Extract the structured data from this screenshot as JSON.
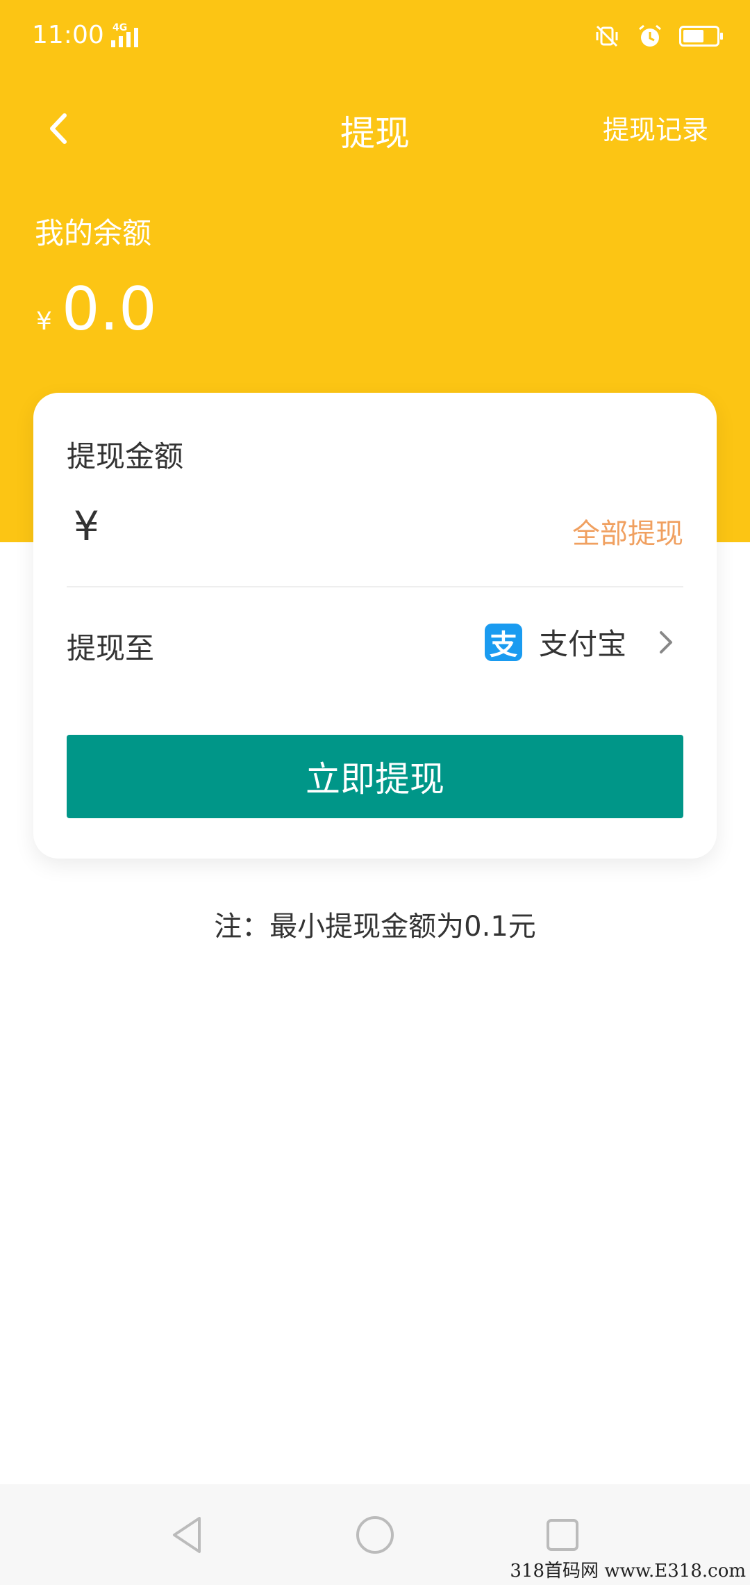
{
  "status_bar": {
    "time": "11:00",
    "network": "4G"
  },
  "nav": {
    "title": "提现",
    "right_link": "提现记录"
  },
  "balance": {
    "label": "我的余额",
    "currency": "¥",
    "amount": "0.0"
  },
  "form": {
    "title": "提现金额",
    "currency": "¥",
    "amount_value": "",
    "withdraw_all_label": "全部提现",
    "destination_label": "提现至",
    "destination_logo_text": "支",
    "destination_name": "支付宝",
    "submit_label": "立即提现"
  },
  "note": "注：最小提现金额为0.1元",
  "watermark": "318首码网 www.E318.com",
  "colors": {
    "header": "#FCC514",
    "primary_button": "#009688",
    "accent_link": "#F0A060",
    "alipay": "#1A9BF0"
  },
  "icons": {
    "back": "chevron-left-icon",
    "mute": "mute-vibrate-icon",
    "alarm": "alarm-icon",
    "battery": "battery-icon",
    "destination_arrow": "chevron-right-icon"
  }
}
